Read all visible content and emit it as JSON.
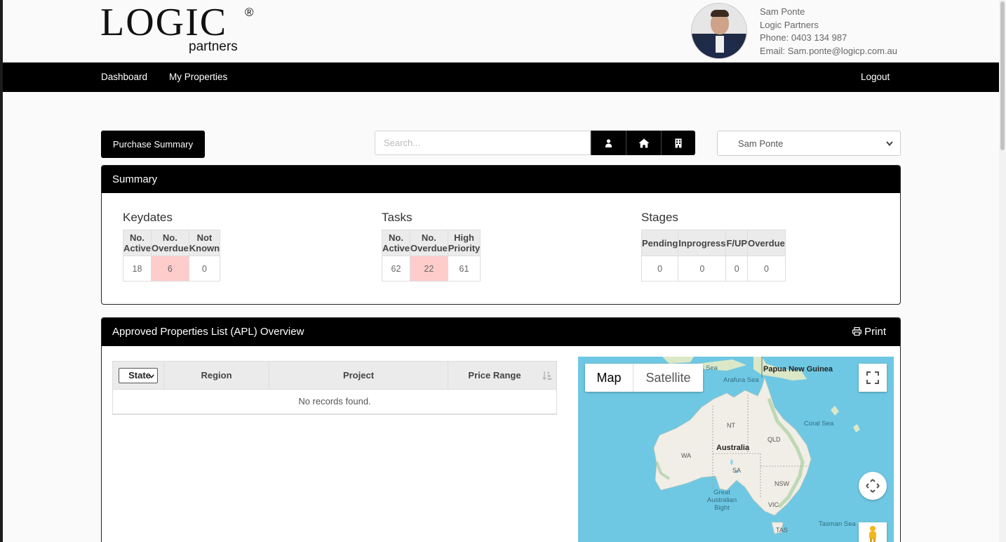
{
  "header": {
    "logo_main": "LOGIC",
    "logo_reg": "®",
    "logo_sub": "partners",
    "contact": {
      "name": "Sam Ponte",
      "company": "Logic Partners",
      "phone": "Phone: 0403 134 987",
      "email": "Email: Sam.ponte@logicp.com.au"
    }
  },
  "nav": {
    "items": [
      "Dashboard",
      "My Properties"
    ],
    "logout": "Logout"
  },
  "toolbar": {
    "summary_button": "Purchase Summary",
    "search_placeholder": "Search...",
    "icon_buttons": [
      "user-icon",
      "home-icon",
      "building-icon"
    ],
    "agent_select": "Sam Ponte"
  },
  "summary": {
    "title": "Summary",
    "keydates": {
      "title": "Keydates",
      "headers": [
        "No. Active",
        "No. Overdue",
        "Not Known"
      ],
      "values": [
        "18",
        "6",
        "0"
      ]
    },
    "tasks": {
      "title": "Tasks",
      "headers": [
        "No. Active",
        "No. Overdue",
        "High Priority"
      ],
      "values": [
        "62",
        "22",
        "61"
      ]
    },
    "stages": {
      "title": "Stages",
      "headers": [
        "Pending",
        "Inprogress",
        "F/UP",
        "Overdue"
      ],
      "values": [
        "0",
        "0",
        "0",
        "0"
      ]
    },
    "alert_color": "#ffcccc"
  },
  "apl": {
    "title": "Approved Properties List (APL) Overview",
    "print": "Print",
    "state_filter": "State",
    "columns": [
      "Region",
      "Project",
      "Price Range"
    ],
    "empty_message": "No records found."
  },
  "map": {
    "tabs": [
      "Map",
      "Satellite"
    ],
    "active_tab": "Map",
    "labels": {
      "png": "Papua New Guinea",
      "arafura": "Arafura Sea",
      "banda": "Sea",
      "coral": "Coral Sea",
      "tasman": "Tasman Sea",
      "australia": "Australia",
      "wa": "WA",
      "nt": "NT",
      "qld": "QLD",
      "sa": "SA",
      "nsw": "NSW",
      "vic": "VIC",
      "tas": "TAS",
      "bight": "Great Australian Bight"
    }
  }
}
